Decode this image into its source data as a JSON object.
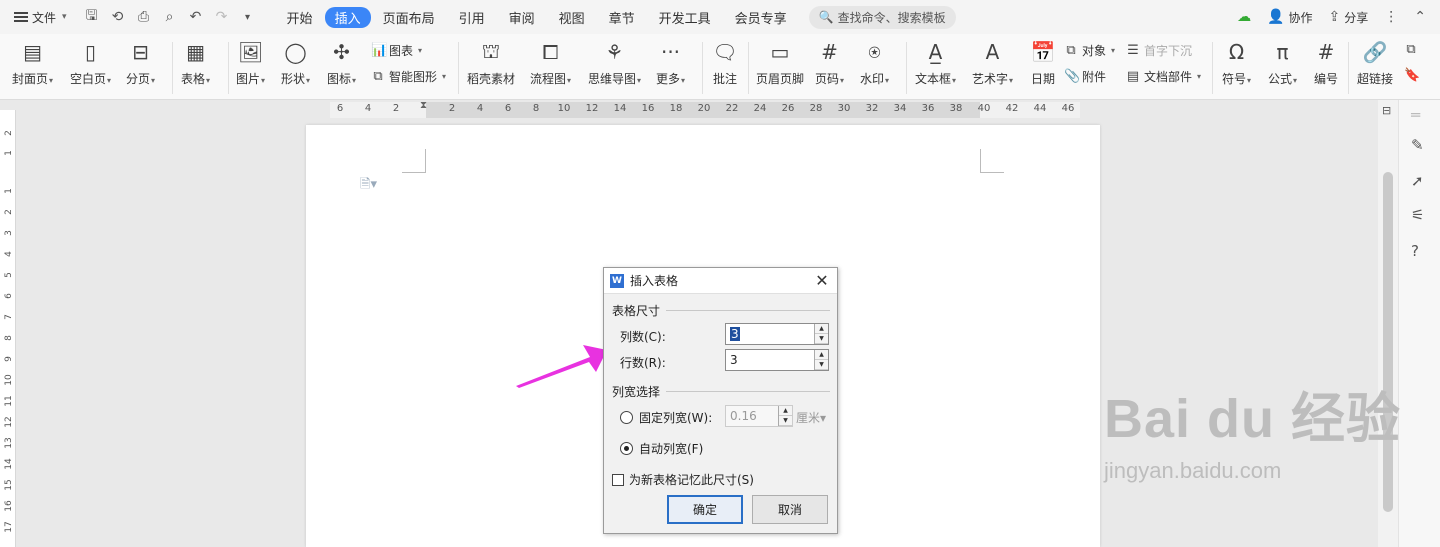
{
  "menubar": {
    "file_label": "文件",
    "tabs": [
      "开始",
      "插入",
      "页面布局",
      "引用",
      "审阅",
      "视图",
      "章节",
      "开发工具",
      "会员专享"
    ],
    "active_tab": "插入",
    "search_placeholder": "查找命令、搜索模板",
    "collab_label": "协作",
    "share_label": "分享"
  },
  "ribbon": {
    "cover": "封面页",
    "blank": "空白页",
    "pagebreak": "分页",
    "table": "表格",
    "picture": "图片",
    "shape": "形状",
    "icon": "图标",
    "chart": "图表",
    "smartart": "智能图形",
    "material": "稻壳素材",
    "flowchart": "流程图",
    "mindmap": "思维导图",
    "more": "更多",
    "comment": "批注",
    "header_footer": "页眉页脚",
    "page_number": "页码",
    "watermark": "水印",
    "textbox": "文本框",
    "wordart": "艺术字",
    "date": "日期",
    "object": "对象",
    "dropcap": "首字下沉",
    "attachment": "附件",
    "docparts": "文档部件",
    "symbol": "符号",
    "formula": "公式",
    "numbering": "编号",
    "hyperlink": "超链接"
  },
  "ruler_ticks": [
    "6",
    "4",
    "2",
    "2",
    "4",
    "6",
    "8",
    "10",
    "12",
    "14",
    "16",
    "18",
    "20",
    "22",
    "24",
    "26",
    "28",
    "30",
    "32",
    "34",
    "36",
    "38",
    "40",
    "42",
    "44",
    "46"
  ],
  "vruler_ticks": [
    "2",
    "1",
    "1",
    "2",
    "3",
    "4",
    "5",
    "6",
    "7",
    "8",
    "9",
    "10",
    "11",
    "12",
    "13",
    "14",
    "15",
    "16",
    "17"
  ],
  "dialog": {
    "title": "插入表格",
    "size_group": "表格尺寸",
    "cols_label": "列数(C):",
    "cols_value": "3",
    "rows_label": "行数(R):",
    "rows_value": "3",
    "width_group": "列宽选择",
    "fixed_label": "固定列宽(W):",
    "fixed_value": "0.16",
    "fixed_unit": "厘米",
    "auto_label": "自动列宽(F)",
    "remember_label": "为新表格记忆此尺寸(S)",
    "ok": "确定",
    "cancel": "取消"
  },
  "watermark": {
    "brand": "Bai du 经验",
    "url": "jingyan.baidu.com"
  },
  "colors": {
    "accent": "#3b86f7",
    "arrow": "#e832e0"
  }
}
